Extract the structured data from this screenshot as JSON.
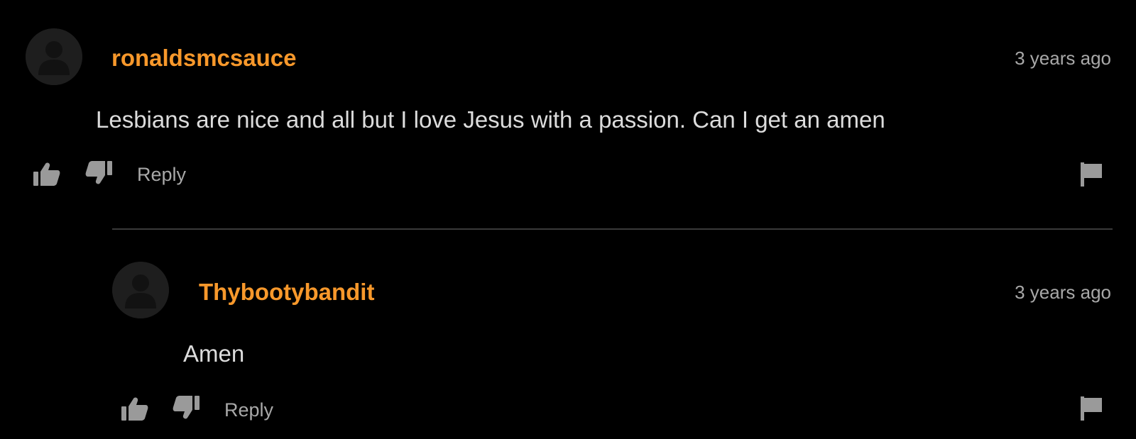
{
  "comments": [
    {
      "username": "ronaldsmcsauce",
      "timestamp": "3 years ago",
      "text": "Lesbians are nice and all but I love Jesus with a passion. Can I get an amen",
      "reply_label": "Reply",
      "icons": {
        "avatar": "default-avatar-icon",
        "like": "thumbs-up-icon",
        "dislike": "thumbs-down-icon",
        "report": "flag-icon"
      }
    }
  ],
  "replies": [
    {
      "username": "Thybootybandit",
      "timestamp": "3 years ago",
      "text": "Amen",
      "reply_label": "Reply",
      "icons": {
        "avatar": "default-avatar-icon",
        "like": "thumbs-up-icon",
        "dislike": "thumbs-down-icon",
        "report": "flag-icon"
      }
    }
  ],
  "colors": {
    "background": "#000000",
    "username": "#f7982b",
    "body_text": "#dcdcdc",
    "muted_text": "#a8a8a8",
    "icon": "#9a9a9a",
    "divider": "#3a3a3a"
  }
}
